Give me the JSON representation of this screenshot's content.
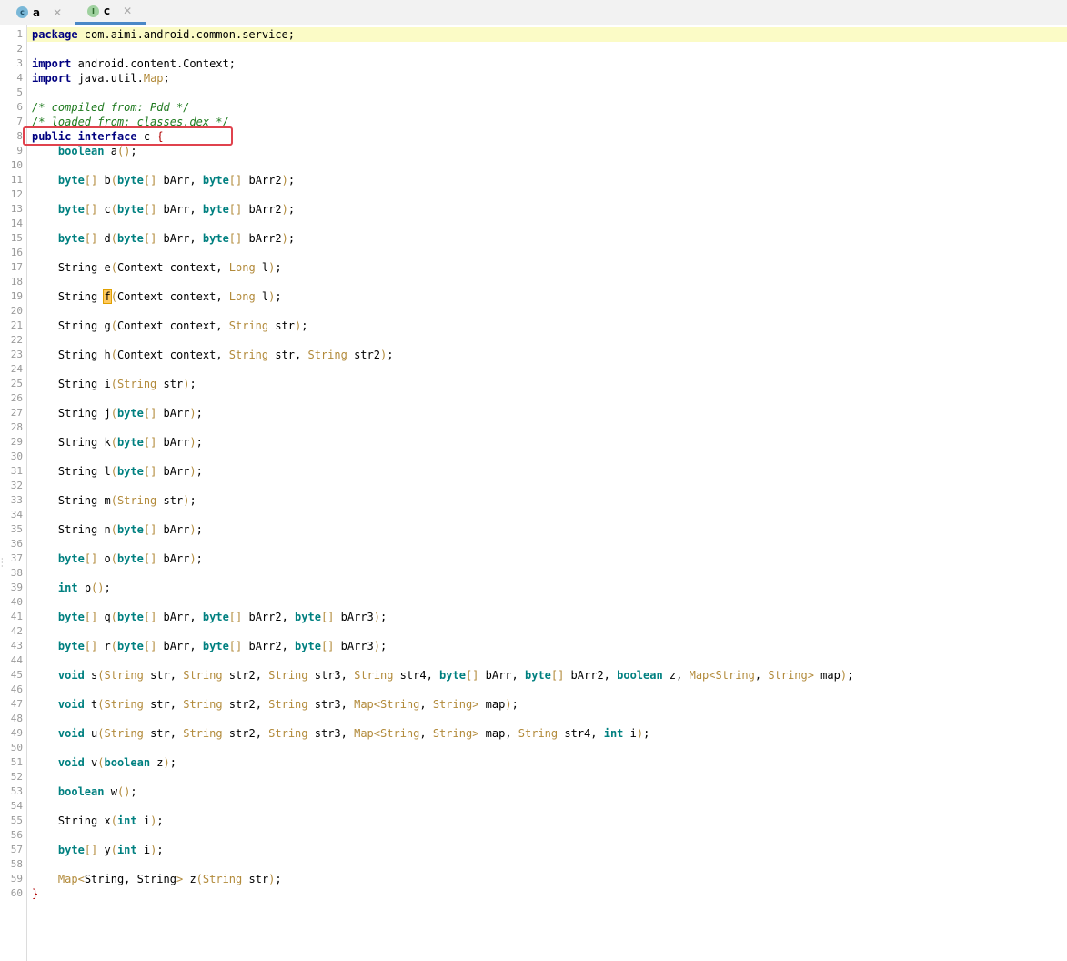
{
  "tabs": [
    {
      "icon_letter": "c",
      "icon_name": "class-icon",
      "label": "a",
      "active": false
    },
    {
      "icon_letter": "I",
      "icon_name": "interface-icon",
      "label": "c",
      "active": true
    }
  ],
  "colors": {
    "keyword": "#000080",
    "type_keyword": "#008080",
    "class_type": "#b28a3a",
    "comment": "#1f7a1f",
    "line_highlight": "#fbfbc6",
    "annotation_box": "#e0424d"
  },
  "editor": {
    "line_numbers": [
      "1",
      "2",
      "3",
      "4",
      "5",
      "6",
      "7",
      "8",
      "9",
      "10",
      "11",
      "12",
      "13",
      "14",
      "15",
      "16",
      "17",
      "18",
      "19",
      "20",
      "21",
      "22",
      "23",
      "24",
      "25",
      "26",
      "27",
      "28",
      "29",
      "30",
      "31",
      "32",
      "33",
      "34",
      "35",
      "36",
      "37",
      "38",
      "39",
      "40",
      "41",
      "42",
      "43",
      "44",
      "45",
      "46",
      "47",
      "48",
      "49",
      "50",
      "51",
      "52",
      "53",
      "54",
      "55",
      "56",
      "57",
      "58",
      "59",
      "60"
    ],
    "lines": [
      "package com.aimi.android.common.service;",
      "",
      "import android.content.Context;",
      "import java.util.Map;",
      "",
      "/* compiled from: Pdd */",
      "/* loaded from: classes.dex */",
      "public interface c {",
      "    boolean a();",
      "",
      "    byte[] b(byte[] bArr, byte[] bArr2);",
      "",
      "    byte[] c(byte[] bArr, byte[] bArr2);",
      "",
      "    byte[] d(byte[] bArr, byte[] bArr2);",
      "",
      "    String e(Context context, Long l);",
      "",
      "    String f(Context context, Long l);",
      "",
      "    String g(Context context, String str);",
      "",
      "    String h(Context context, String str, String str2);",
      "",
      "    String i(String str);",
      "",
      "    String j(byte[] bArr);",
      "",
      "    String k(byte[] bArr);",
      "",
      "    String l(byte[] bArr);",
      "",
      "    String m(String str);",
      "",
      "    String n(byte[] bArr);",
      "",
      "    byte[] o(byte[] bArr);",
      "",
      "    int p();",
      "",
      "    byte[] q(byte[] bArr, byte[] bArr2, byte[] bArr3);",
      "",
      "    byte[] r(byte[] bArr, byte[] bArr2, byte[] bArr3);",
      "",
      "    void s(String str, String str2, String str3, String str4, byte[] bArr, byte[] bArr2, boolean z, Map<String, String> map);",
      "",
      "    void t(String str, String str2, String str3, Map<String, String> map);",
      "",
      "    void u(String str, String str2, String str3, Map<String, String> map, String str4, int i);",
      "",
      "    void v(boolean z);",
      "",
      "    boolean w();",
      "",
      "    String x(int i);",
      "",
      "    byte[] y(int i);",
      "",
      "    Map<String, String> z(String str);",
      "}"
    ]
  }
}
